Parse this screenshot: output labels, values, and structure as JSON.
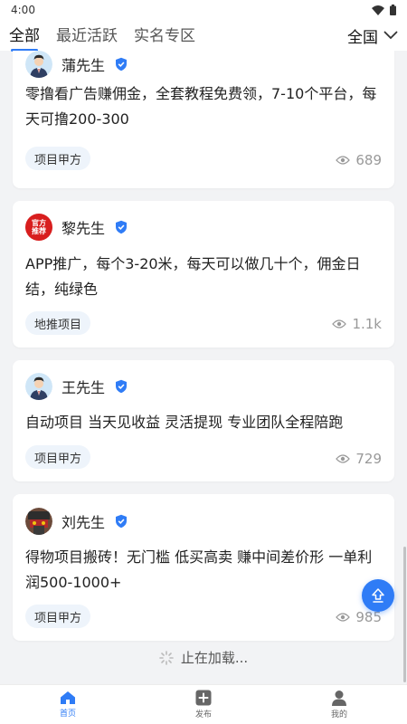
{
  "status_bar": {
    "time": "4:00"
  },
  "tabs": [
    {
      "label": "全部",
      "active": true
    },
    {
      "label": "最近活跃",
      "active": false
    },
    {
      "label": "实名专区",
      "active": false
    }
  ],
  "region": {
    "label": "全国"
  },
  "posts": [
    {
      "author": "蒲先生",
      "text": "零撸看广告赚佣金，全套教程免费领，7-10个平台，每天可撸200-300",
      "tag": "项目甲方",
      "views": "689",
      "avatar": "avatar-businessman",
      "verified_color": "#2f7cf6"
    },
    {
      "author": "黎先生",
      "text": "APP推广，每个3-20米，每天可以做几十个，佣金日结，纯绿色",
      "tag": "地推项目",
      "views": "1.1k",
      "avatar": "avatar-official-badge",
      "avatar_text_1": "官方",
      "avatar_text_2": "推荐",
      "verified_color": "#2f7cf6"
    },
    {
      "author": "王先生",
      "text": "自动项目 当天见收益 灵活提现 专业团队全程陪跑",
      "tag": "项目甲方",
      "views": "729",
      "avatar": "avatar-businessman",
      "verified_color": "#2f7cf6"
    },
    {
      "author": "刘先生",
      "text": "得物项目搬砖！无门槛 低买高卖 赚中间差价形 一单利润500-1000+",
      "tag": "项目甲方",
      "views": "985",
      "avatar": "avatar-photo",
      "verified_color": "#2f7cf6"
    }
  ],
  "loading_text": "止在加载...",
  "bottom_nav": [
    {
      "label": "首页",
      "icon": "home-icon",
      "active": true
    },
    {
      "label": "发布",
      "icon": "add-icon",
      "active": false
    },
    {
      "label": "我的",
      "icon": "user-icon",
      "active": false
    }
  ],
  "colors": {
    "accent": "#2f7cf6",
    "background": "#f2f3f5",
    "tag_bg": "#eef4fb"
  }
}
